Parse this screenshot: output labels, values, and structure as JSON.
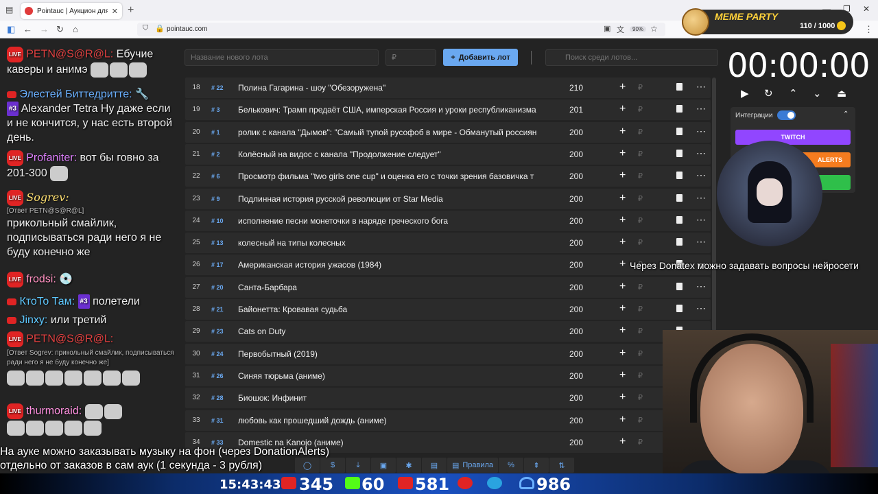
{
  "browser": {
    "tab_title": "Pointauc | Аукцион для стримеров",
    "url": "pointauc.com",
    "zoom": "90%"
  },
  "meme_party": {
    "title": "MEME PARTY",
    "counter": "110 / 1000"
  },
  "toolbar": {
    "lot_name_placeholder": "Название нового лота",
    "amount_placeholder": "₽",
    "add_lot_label": "Добавить лот",
    "search_placeholder": "Поиск среди лотов..."
  },
  "lots": [
    {
      "num": "18",
      "id": "# 22",
      "name": "Полина Гагарина - шоу \"Обезоружена\"",
      "amount": "210"
    },
    {
      "num": "19",
      "id": "# 3",
      "name": "Белькович: Трамп предаёт США, имперская Россия и уроки республиканизма",
      "amount": "201"
    },
    {
      "num": "20",
      "id": "# 1",
      "name": "ролик с канала \"Дымов\": \"Самый тупой русофоб в мире - Обманутый россиян",
      "amount": "200"
    },
    {
      "num": "21",
      "id": "# 2",
      "name": "Колёсный на видос с канала \"Продолжение следует\"",
      "amount": "200"
    },
    {
      "num": "22",
      "id": "# 6",
      "name": "Просмотр фильма \"two girls one cup\" и оценка его с точки зрения базовичка т",
      "amount": "200"
    },
    {
      "num": "23",
      "id": "# 9",
      "name": "Подлинная история русской революции от Star Media",
      "amount": "200"
    },
    {
      "num": "24",
      "id": "# 10",
      "name": "исполнение песни монеточки в наряде греческого бога",
      "amount": "200"
    },
    {
      "num": "25",
      "id": "# 13",
      "name": "колесный на типы колесных",
      "amount": "200"
    },
    {
      "num": "26",
      "id": "# 17",
      "name": "Американская история ужасов (1984)",
      "amount": "200"
    },
    {
      "num": "27",
      "id": "# 20",
      "name": "Санта-Барбара",
      "amount": "200"
    },
    {
      "num": "28",
      "id": "# 21",
      "name": "Байонетта: Кровавая судьба",
      "amount": "200"
    },
    {
      "num": "29",
      "id": "# 23",
      "name": "Cats on Duty",
      "amount": "200"
    },
    {
      "num": "30",
      "id": "# 24",
      "name": "Первобытный (2019)",
      "amount": "200"
    },
    {
      "num": "31",
      "id": "# 26",
      "name": "Синяя тюрьма (аниме)",
      "amount": "200"
    },
    {
      "num": "32",
      "id": "# 28",
      "name": "Биошок: Инфинит",
      "amount": "200"
    },
    {
      "num": "33",
      "id": "# 31",
      "name": "любовь как прошедший дождь (аниме)",
      "amount": "200"
    },
    {
      "num": "34",
      "id": "# 33",
      "name": "Domestic na Kanojo (аниме)",
      "amount": "200"
    }
  ],
  "timer": {
    "value": "00:00:00"
  },
  "integrations": {
    "label": "Интеграции",
    "twitch": "TWITCH",
    "alerts": "ALERTS"
  },
  "chat": [
    {
      "user": "PETN@S@R@L:",
      "text": "Ебучие каверы и анимэ"
    },
    {
      "user": "Элестей Биттедритте:",
      "text": ""
    },
    {
      "user": "Alexander Tetra",
      "badge": "#3",
      "text": "Ну даже если и не кончится, у нас есть второй день."
    },
    {
      "user": "Profaniter:",
      "text": "вот бы говно за 201-300"
    },
    {
      "user": "Sogrev:",
      "text": ""
    },
    {
      "reply": "[Ответ PETN@S@R@L]",
      "text": "прикольный смайлик, подписываться ради него я не буду конечно же"
    },
    {
      "user": "frodsi:",
      "text": ""
    },
    {
      "user": "КтоТо Там:",
      "badge": "#3",
      "text": "полетели"
    },
    {
      "user": "Jinxy:",
      "text": "или третий"
    },
    {
      "user": "PETN@S@R@L:",
      "text": ""
    },
    {
      "reply": "[Ответ Sogrev: прикольный смайлик, подписываться ради него я не буду конечно же]",
      "text": ""
    },
    {
      "user": "thurmoraid:",
      "text": ""
    }
  ],
  "tip_text": "Через Donatex можно задавать вопросы нейросети",
  "subtitle_lines": [
    "На ауке можно заказывать музыку на фон (через DonationAlerts)",
    "отдельно от заказов в сам аук (1 секунда - 3 рубля)"
  ],
  "bottom_buttons": {
    "rules": "Правила"
  },
  "status": {
    "time": "15:43:43",
    "youtube": "345",
    "kick": "60",
    "vk": "581",
    "telegram": "986"
  },
  "colors": {
    "accent": "#6aa8f0",
    "twitch": "#9146ff",
    "alerts": "#f57c1f",
    "green": "#2fbf4a"
  }
}
